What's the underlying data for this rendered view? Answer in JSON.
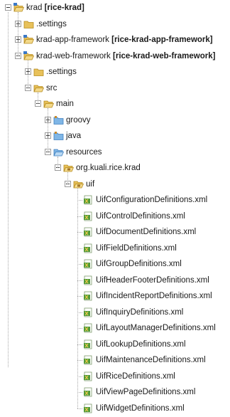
{
  "tree": {
    "nodes": [
      {
        "label": "krad",
        "suffix": "[rice-krad]",
        "depth": 0,
        "icon": "project-folder-icon",
        "toggle": "expanded"
      },
      {
        "label": ".settings",
        "suffix": "",
        "depth": 1,
        "icon": "folder-icon",
        "toggle": "collapsed"
      },
      {
        "label": "krad-app-framework",
        "suffix": "[rice-krad-app-framework]",
        "depth": 1,
        "icon": "project-folder-icon",
        "toggle": "collapsed"
      },
      {
        "label": "krad-web-framework",
        "suffix": "[rice-krad-web-framework]",
        "depth": 1,
        "icon": "project-folder-icon",
        "toggle": "expanded"
      },
      {
        "label": ".settings",
        "suffix": "",
        "depth": 2,
        "icon": "folder-icon",
        "toggle": "collapsed"
      },
      {
        "label": "src",
        "suffix": "",
        "depth": 2,
        "icon": "folder-open-icon",
        "toggle": "expanded"
      },
      {
        "label": "main",
        "suffix": "",
        "depth": 3,
        "icon": "folder-open-icon",
        "toggle": "expanded"
      },
      {
        "label": "groovy",
        "suffix": "",
        "depth": 4,
        "icon": "source-folder-icon",
        "toggle": "collapsed"
      },
      {
        "label": "java",
        "suffix": "",
        "depth": 4,
        "icon": "source-folder-icon",
        "toggle": "collapsed"
      },
      {
        "label": "resources",
        "suffix": "",
        "depth": 4,
        "icon": "source-folder-open-icon",
        "toggle": "expanded"
      },
      {
        "label": "org.kuali.rice.krad",
        "suffix": "",
        "depth": 5,
        "icon": "package-folder-icon",
        "toggle": "expanded"
      },
      {
        "label": "uif",
        "suffix": "",
        "depth": 6,
        "icon": "package-folder-icon",
        "toggle": "expanded"
      },
      {
        "label": "UifConfigurationDefinitions.xml",
        "suffix": "",
        "depth": 7,
        "icon": "xml-file-icon",
        "toggle": "none"
      },
      {
        "label": "UifControlDefinitions.xml",
        "suffix": "",
        "depth": 7,
        "icon": "xml-file-icon",
        "toggle": "none"
      },
      {
        "label": "UifDocumentDefinitions.xml",
        "suffix": "",
        "depth": 7,
        "icon": "xml-file-icon",
        "toggle": "none"
      },
      {
        "label": "UifFieldDefinitions.xml",
        "suffix": "",
        "depth": 7,
        "icon": "xml-file-icon",
        "toggle": "none"
      },
      {
        "label": "UifGroupDefinitions.xml",
        "suffix": "",
        "depth": 7,
        "icon": "xml-file-icon",
        "toggle": "none"
      },
      {
        "label": "UifHeaderFooterDefinitions.xml",
        "suffix": "",
        "depth": 7,
        "icon": "xml-file-icon",
        "toggle": "none"
      },
      {
        "label": "UifIncidentReportDefinitions.xml",
        "suffix": "",
        "depth": 7,
        "icon": "xml-file-icon",
        "toggle": "none"
      },
      {
        "label": "UifInquiryDefinitions.xml",
        "suffix": "",
        "depth": 7,
        "icon": "xml-file-icon",
        "toggle": "none"
      },
      {
        "label": "UifLayoutManagerDefinitions.xml",
        "suffix": "",
        "depth": 7,
        "icon": "xml-file-icon",
        "toggle": "none"
      },
      {
        "label": "UifLookupDefinitions.xml",
        "suffix": "",
        "depth": 7,
        "icon": "xml-file-icon",
        "toggle": "none"
      },
      {
        "label": "UifMaintenanceDefinitions.xml",
        "suffix": "",
        "depth": 7,
        "icon": "xml-file-icon",
        "toggle": "none"
      },
      {
        "label": "UifRiceDefinitions.xml",
        "suffix": "",
        "depth": 7,
        "icon": "xml-file-icon",
        "toggle": "none"
      },
      {
        "label": "UifViewPageDefinitions.xml",
        "suffix": "",
        "depth": 7,
        "icon": "xml-file-icon",
        "toggle": "none"
      },
      {
        "label": "UifWidgetDefinitions.xml",
        "suffix": "",
        "depth": 7,
        "icon": "xml-file-icon",
        "toggle": "none"
      }
    ]
  },
  "colors": {
    "folder": "#e8c15a",
    "folder_dark": "#b58a1e",
    "source_folder": "#7fb6e6",
    "source_folder_dark": "#3f7fbf",
    "xml_green": "#4f9a3a",
    "xml_yellow": "#e8c94a",
    "project_badge": "#3a78c9"
  }
}
